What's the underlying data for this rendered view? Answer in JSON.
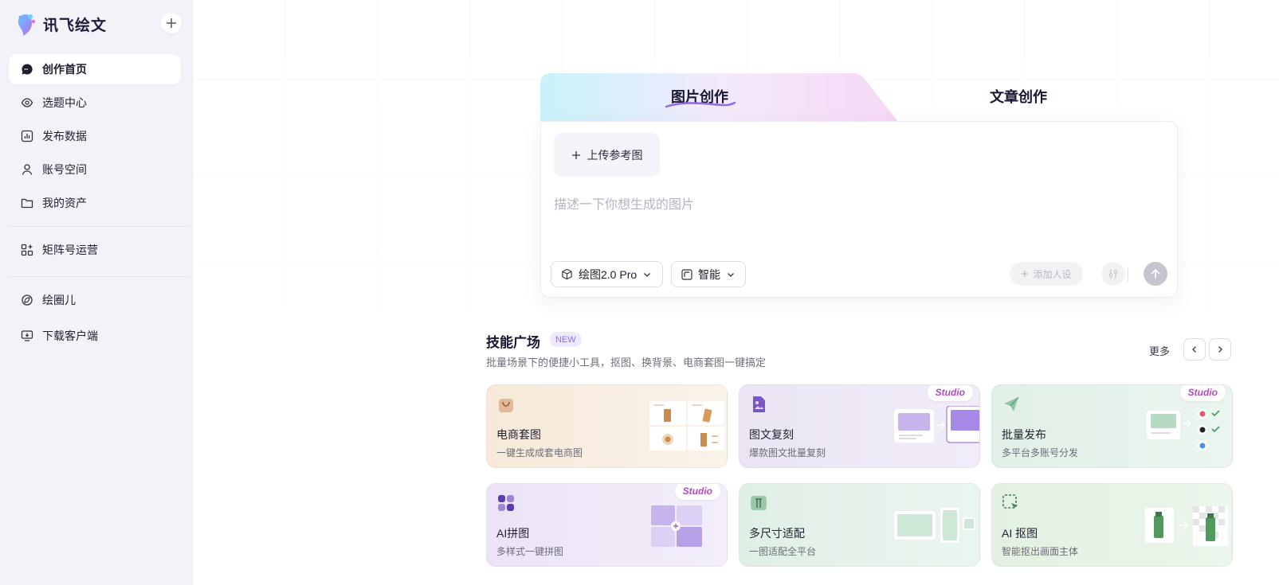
{
  "sidebar": {
    "brand": "讯飞绘文",
    "items": [
      {
        "label": "创作首页",
        "icon": "chat-bubble-icon",
        "active": true
      },
      {
        "label": "选题中心",
        "icon": "eye-icon"
      },
      {
        "label": "发布数据",
        "icon": "bar-chart-icon"
      },
      {
        "label": "账号空间",
        "icon": "user-icon"
      },
      {
        "label": "我的资产",
        "icon": "folder-icon"
      },
      {
        "label": "矩阵号运营",
        "icon": "grid-plus-icon"
      },
      {
        "label": "绘圈儿",
        "icon": "leaf-circle-icon"
      },
      {
        "label": "下载客户端",
        "icon": "monitor-download-icon"
      }
    ]
  },
  "creation": {
    "tab_image": "图片创作",
    "tab_article": "文章创作",
    "upload_label": "上传参考图",
    "prompt_placeholder": "描述一下你想生成的图片",
    "model_label": "绘图2.0 Pro",
    "ratio_label": "智能",
    "add_persona": "添加人设"
  },
  "skills": {
    "title": "技能广场",
    "badge": "NEW",
    "subtitle": "批量场景下的便捷小工具，抠图、换背景、电商套图一键搞定",
    "more": "更多",
    "studio_label": "Studio",
    "cards": [
      {
        "name": "电商套图",
        "desc": "一键生成成套电商图",
        "bg": "#f7ecdd"
      },
      {
        "name": "图文复刻",
        "desc": "爆款图文批量复刻",
        "bg": "#ece6f4"
      },
      {
        "name": "批量发布",
        "desc": "多平台多账号分发",
        "bg": "#e3f1ea"
      },
      {
        "name": "AI拼图",
        "desc": "多样式一键拼图",
        "bg": "#ece6f5"
      },
      {
        "name": "多尺寸适配",
        "desc": "一图适配全平台",
        "bg": "#e2f1e8"
      },
      {
        "name": "AI 抠图",
        "desc": "智能抠出画面主体",
        "bg": "#e5f2e6"
      }
    ]
  },
  "colors": {
    "accent": "#8b6cf3",
    "studio": "#b44ac0"
  }
}
